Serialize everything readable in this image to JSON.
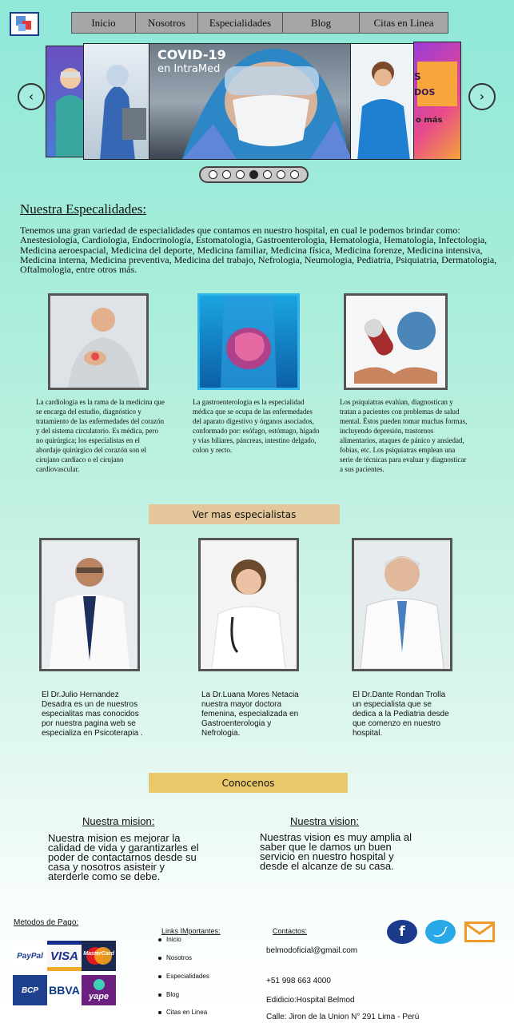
{
  "nav": {
    "items": [
      "Inicio",
      "Nosotros",
      "Especialidades",
      "Blog",
      "Citas en Linea"
    ]
  },
  "carousel": {
    "slide_title": "COVID-19",
    "slide_subtitle": "en IntraMed",
    "side_text_1": "S",
    "side_text_2": "DOS",
    "side_text_3": "o más",
    "dots": 7,
    "active_dot": 4
  },
  "especialidades": {
    "heading": "Nuestra Especalidades:",
    "intro": "Tenemos una gran variedad de especialidades que contamos en nuestro hospital, en cual le podemos brindar como: Anestesiología, Cardiologia, Endocrinología, Estomatologia, Gastroenterologia, Hematologia, Hematología, Infectologia, Medicina aeroespacial, Medicina del deporte, Medicina familiar, Medicina física, Medicina forenze, Medicina intensiva, Medicina interna, Medicina preventiva, Medicina del trabajo, Nefrologia, Neumologia, Pediatria, Psiquiatria, Dermatologia, Oftalmologia, entre otros más.",
    "cards": [
      {
        "text": "La cardiologia es la rama de la medicina que se encarga del estudio, diagnóstico y tratamiento de las enfermedades del corazón y del sistema circulatorio. Es médica, pero no quirúrgica; los especialistas en el abordaje quirúrgico del corazón son el cirujano cardíaco o el cirujano cardiovascular."
      },
      {
        "text": "La gastroenterologia es la especialidad médica que se ocupa de las enfermedades del aparato digestivo y órganos asociados, conformado por: esófago, estómago, hígado y vías biliares, páncreas, intestino delgado, colon y recto."
      },
      {
        "text": "Los psiquiatras evalúan, diagnostican y tratan a pacientes con problemas de salud mental. Éstos pueden tomar muchas formas, incluyendo depresión, trastornos alimentarios, ataques de pánico y ansiedad, fobias, etc. Los psiquiatras emplean una serie de técnicas para evaluar y diagnosticar a sus pacientes."
      }
    ],
    "more_button": "Ver mas especialistas"
  },
  "doctores": [
    {
      "text": "El Dr.Julio Hernandez Desadra es un de nuestros especialitas mas conocidos por nuestra pagina web se especializa en Psicoterapia ."
    },
    {
      "text": "La Dr.Luana Mores Netacia nuestra mayor doctora femenina, especializada en Gastroenterologia y Nefrologia."
    },
    {
      "text": "El Dr.Dante Rondan Trolla un especialista que se dedica a la Pediatria desde que comenzo en nuestro hospital."
    }
  ],
  "conocenos": {
    "button": "Conocenos",
    "mision_title": "Nuestra mision:",
    "mision_text": "Nuestra mision es mejorar la calidad de vida y garantizarles el poder de contactarnos desde su casa y nosotros asisteir y aterderle como se debe.",
    "vision_title": "Nuestra vision:",
    "vision_text": "Nuestras vision es muy amplia al saber que le damos un buen servicio en nuestro hospital y desde el alcanze de su casa."
  },
  "footer": {
    "payment_title": "Metodos de Pago:",
    "payments": [
      "PayPal",
      "VISA",
      "MasterCard",
      "BCP",
      "BBVA",
      "yape"
    ],
    "links_title": "Links IMportantes:",
    "links": [
      "Inicio",
      "Nosotros",
      "Especialidades",
      "Blog",
      "Citas en Linea"
    ],
    "contacts_title": "Contactos:",
    "email": "belmodoficial@gmail.com",
    "phone": "+51 998 663 4000",
    "building": "Edidicio:Hospital Belmod",
    "address": "Calle: Jiron de la Union N° 291 Lima - Perú",
    "social": [
      "facebook-icon",
      "twitter-icon",
      "mail-icon"
    ]
  },
  "colors": {
    "ver_mas_bg": "#e3c79a",
    "conocenos_bg": "#e9c86a",
    "facebook": "#1b3a8c",
    "twitter": "#29a8e8",
    "mail": "#f09a2a"
  }
}
